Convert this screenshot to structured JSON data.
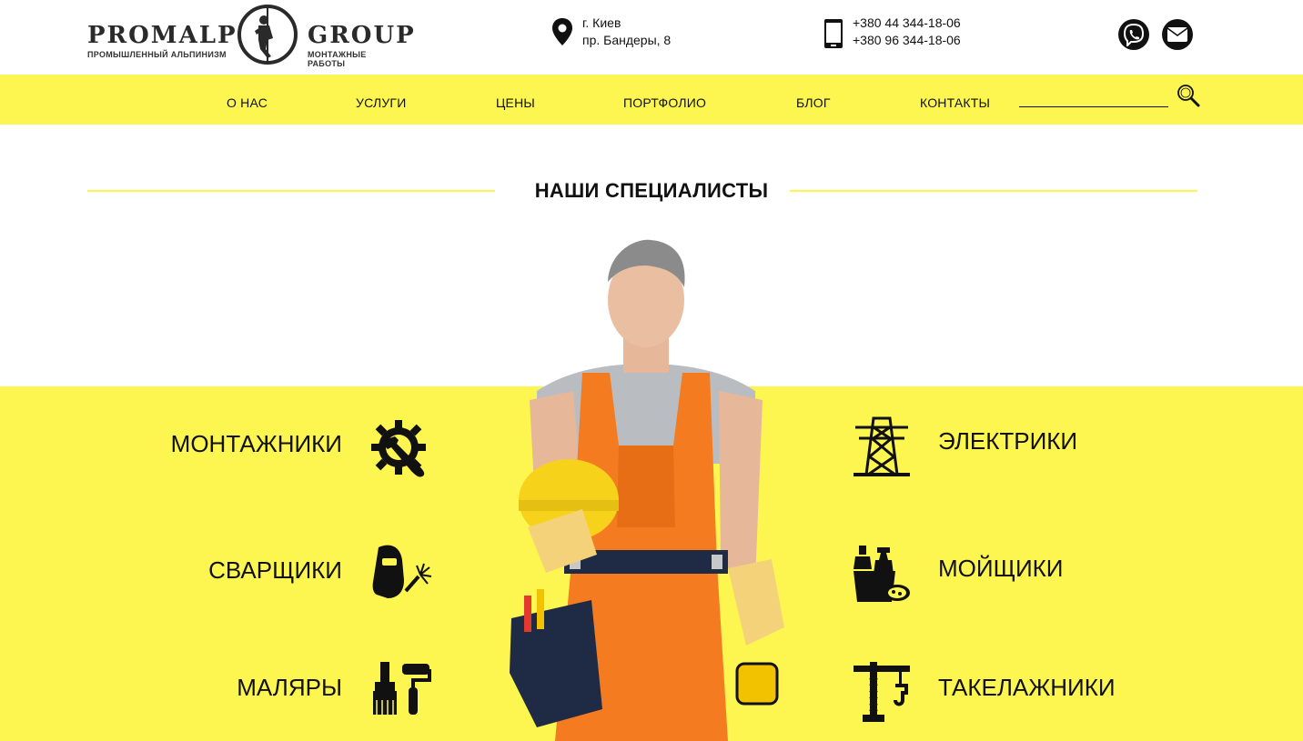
{
  "brand": {
    "word_left": "PROMALP",
    "word_right": "GROUP",
    "sub_left": "ПРОМЫШЛЕННЫЙ АЛЬПИНИЗМ",
    "sub_right": "МОНТАЖНЫЕ РАБОТЫ",
    "emblem_icon": "climber-emblem-icon"
  },
  "contacts": {
    "address_line1": "г. Киев",
    "address_line2": "пр. Бандеры, 8",
    "address_icon": "map-pin-icon",
    "phone1": "+380 44 344-18-06",
    "phone2": "+380 96 344-18-06",
    "phone_icon": "smartphone-icon"
  },
  "social": [
    {
      "name": "viber",
      "icon": "viber-icon"
    },
    {
      "name": "email",
      "icon": "envelope-icon"
    }
  ],
  "nav": {
    "items": [
      "О НАС",
      "УСЛУГИ",
      "ЦЕНЫ",
      "ПОРТФОЛИО",
      "БЛОГ",
      "КОНТАКТЫ"
    ],
    "search_placeholder": "",
    "search_icon": "magnifier-icon"
  },
  "section": {
    "title": "НАШИ СПЕЦИАЛИСТЫ"
  },
  "specialists": {
    "left": [
      {
        "label": "МОНТАЖНИКИ",
        "icon": "gear-wrench-icon"
      },
      {
        "label": "СВАРЩИКИ",
        "icon": "welding-mask-icon"
      },
      {
        "label": "МАЛЯРЫ",
        "icon": "paint-roller-brush-icon"
      }
    ],
    "right": [
      {
        "label": "ЭЛЕКТРИКИ",
        "icon": "power-tower-icon"
      },
      {
        "label": "МОЙЩИКИ",
        "icon": "cleaning-supplies-icon"
      },
      {
        "label": "ТАКЕЛАЖНИКИ",
        "icon": "crane-hook-icon"
      }
    ]
  },
  "colors": {
    "accent_yellow": "#fdf650",
    "text": "#111111",
    "overalls_orange": "#f47b20"
  }
}
